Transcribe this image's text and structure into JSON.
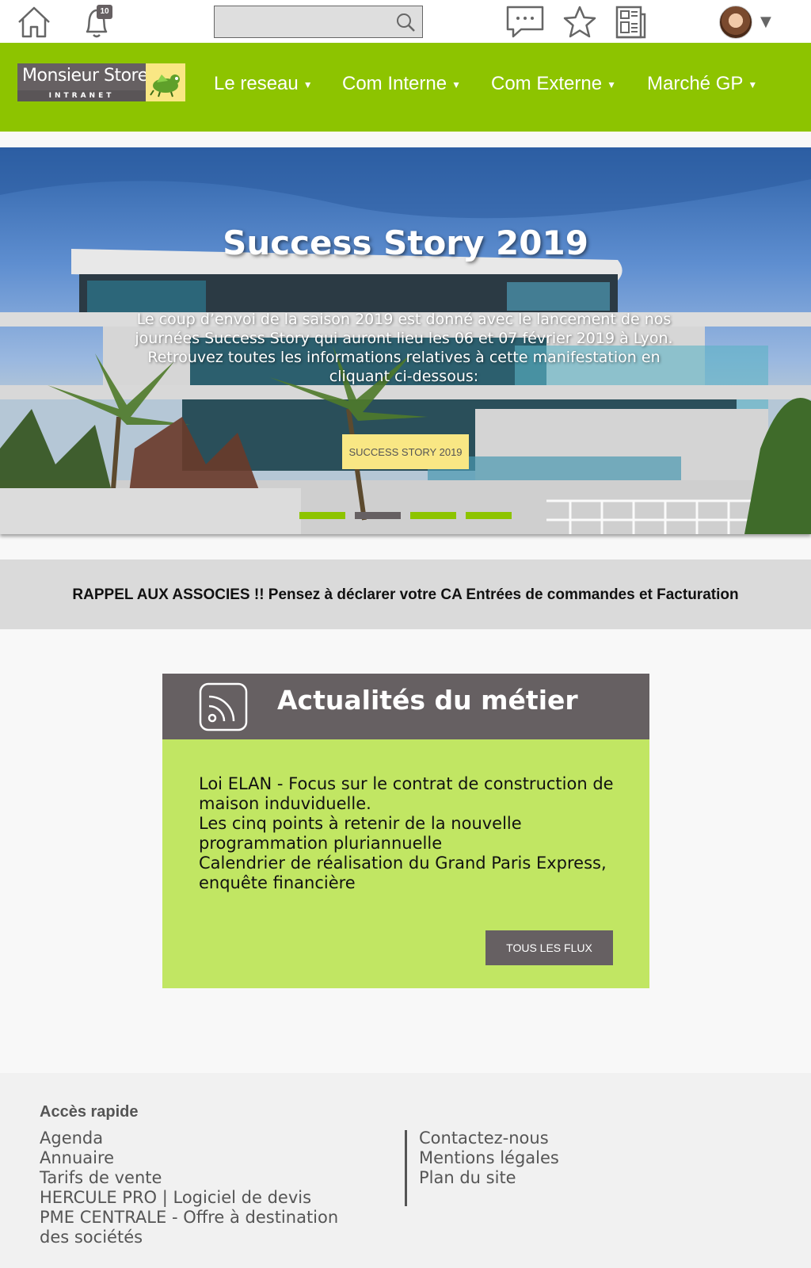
{
  "topbar": {
    "notification_count": "10",
    "search": {
      "value": "",
      "placeholder": ""
    }
  },
  "nav": {
    "logo_name": "Monsieur Store",
    "logo_sub": "INTRANET",
    "items": [
      {
        "label": "Le reseau"
      },
      {
        "label": "Com Interne"
      },
      {
        "label": "Com Externe"
      },
      {
        "label": "Marché GP"
      }
    ]
  },
  "hero": {
    "title": "Success Story 2019",
    "text": "Le coup d’envoi de la saison 2019 est donné avec le lancement de nos journées Success Story qui auront lieu les 06 et 07 février 2019 à Lyon. Retrouvez toutes les informations relatives à cette manifestation en cliquant ci-dessous:",
    "button_label": "SUCCESS STORY 2019",
    "slides": 4,
    "active_slide": 2
  },
  "reminder": {
    "text": "RAPPEL AUX ASSOCIES !! Pensez à déclarer votre CA Entrées de commandes et Facturation"
  },
  "news": {
    "title": "Actualités du métier",
    "items": [
      "Loi ELAN - Focus sur le contrat de construction de maison induviduelle.",
      "Les cinq points à retenir de la nouvelle programmation pluriannuelle",
      "Calendrier de réalisation du Grand Paris Express, enquête financière"
    ],
    "button_label": "TOUS LES FLUX"
  },
  "footer": {
    "heading": "Accès rapide",
    "quick_links": [
      "Agenda",
      "Annuaire",
      "Tarifs de vente",
      "HERCULE PRO | Logiciel de devis",
      "PME CENTRALE - Offre à destination des sociétés"
    ],
    "links": [
      "Contactez-nous",
      "Mentions légales",
      "Plan du site"
    ]
  },
  "colors": {
    "brand_green": "#8dc400",
    "news_green": "#c1e663",
    "dark_grey": "#666062",
    "accent_yellow": "#f9e784"
  },
  "icons": [
    "home-icon",
    "bell-icon",
    "search-icon",
    "chat-icon",
    "star-icon",
    "newspaper-icon",
    "rss-icon",
    "chevron-down-icon"
  ]
}
